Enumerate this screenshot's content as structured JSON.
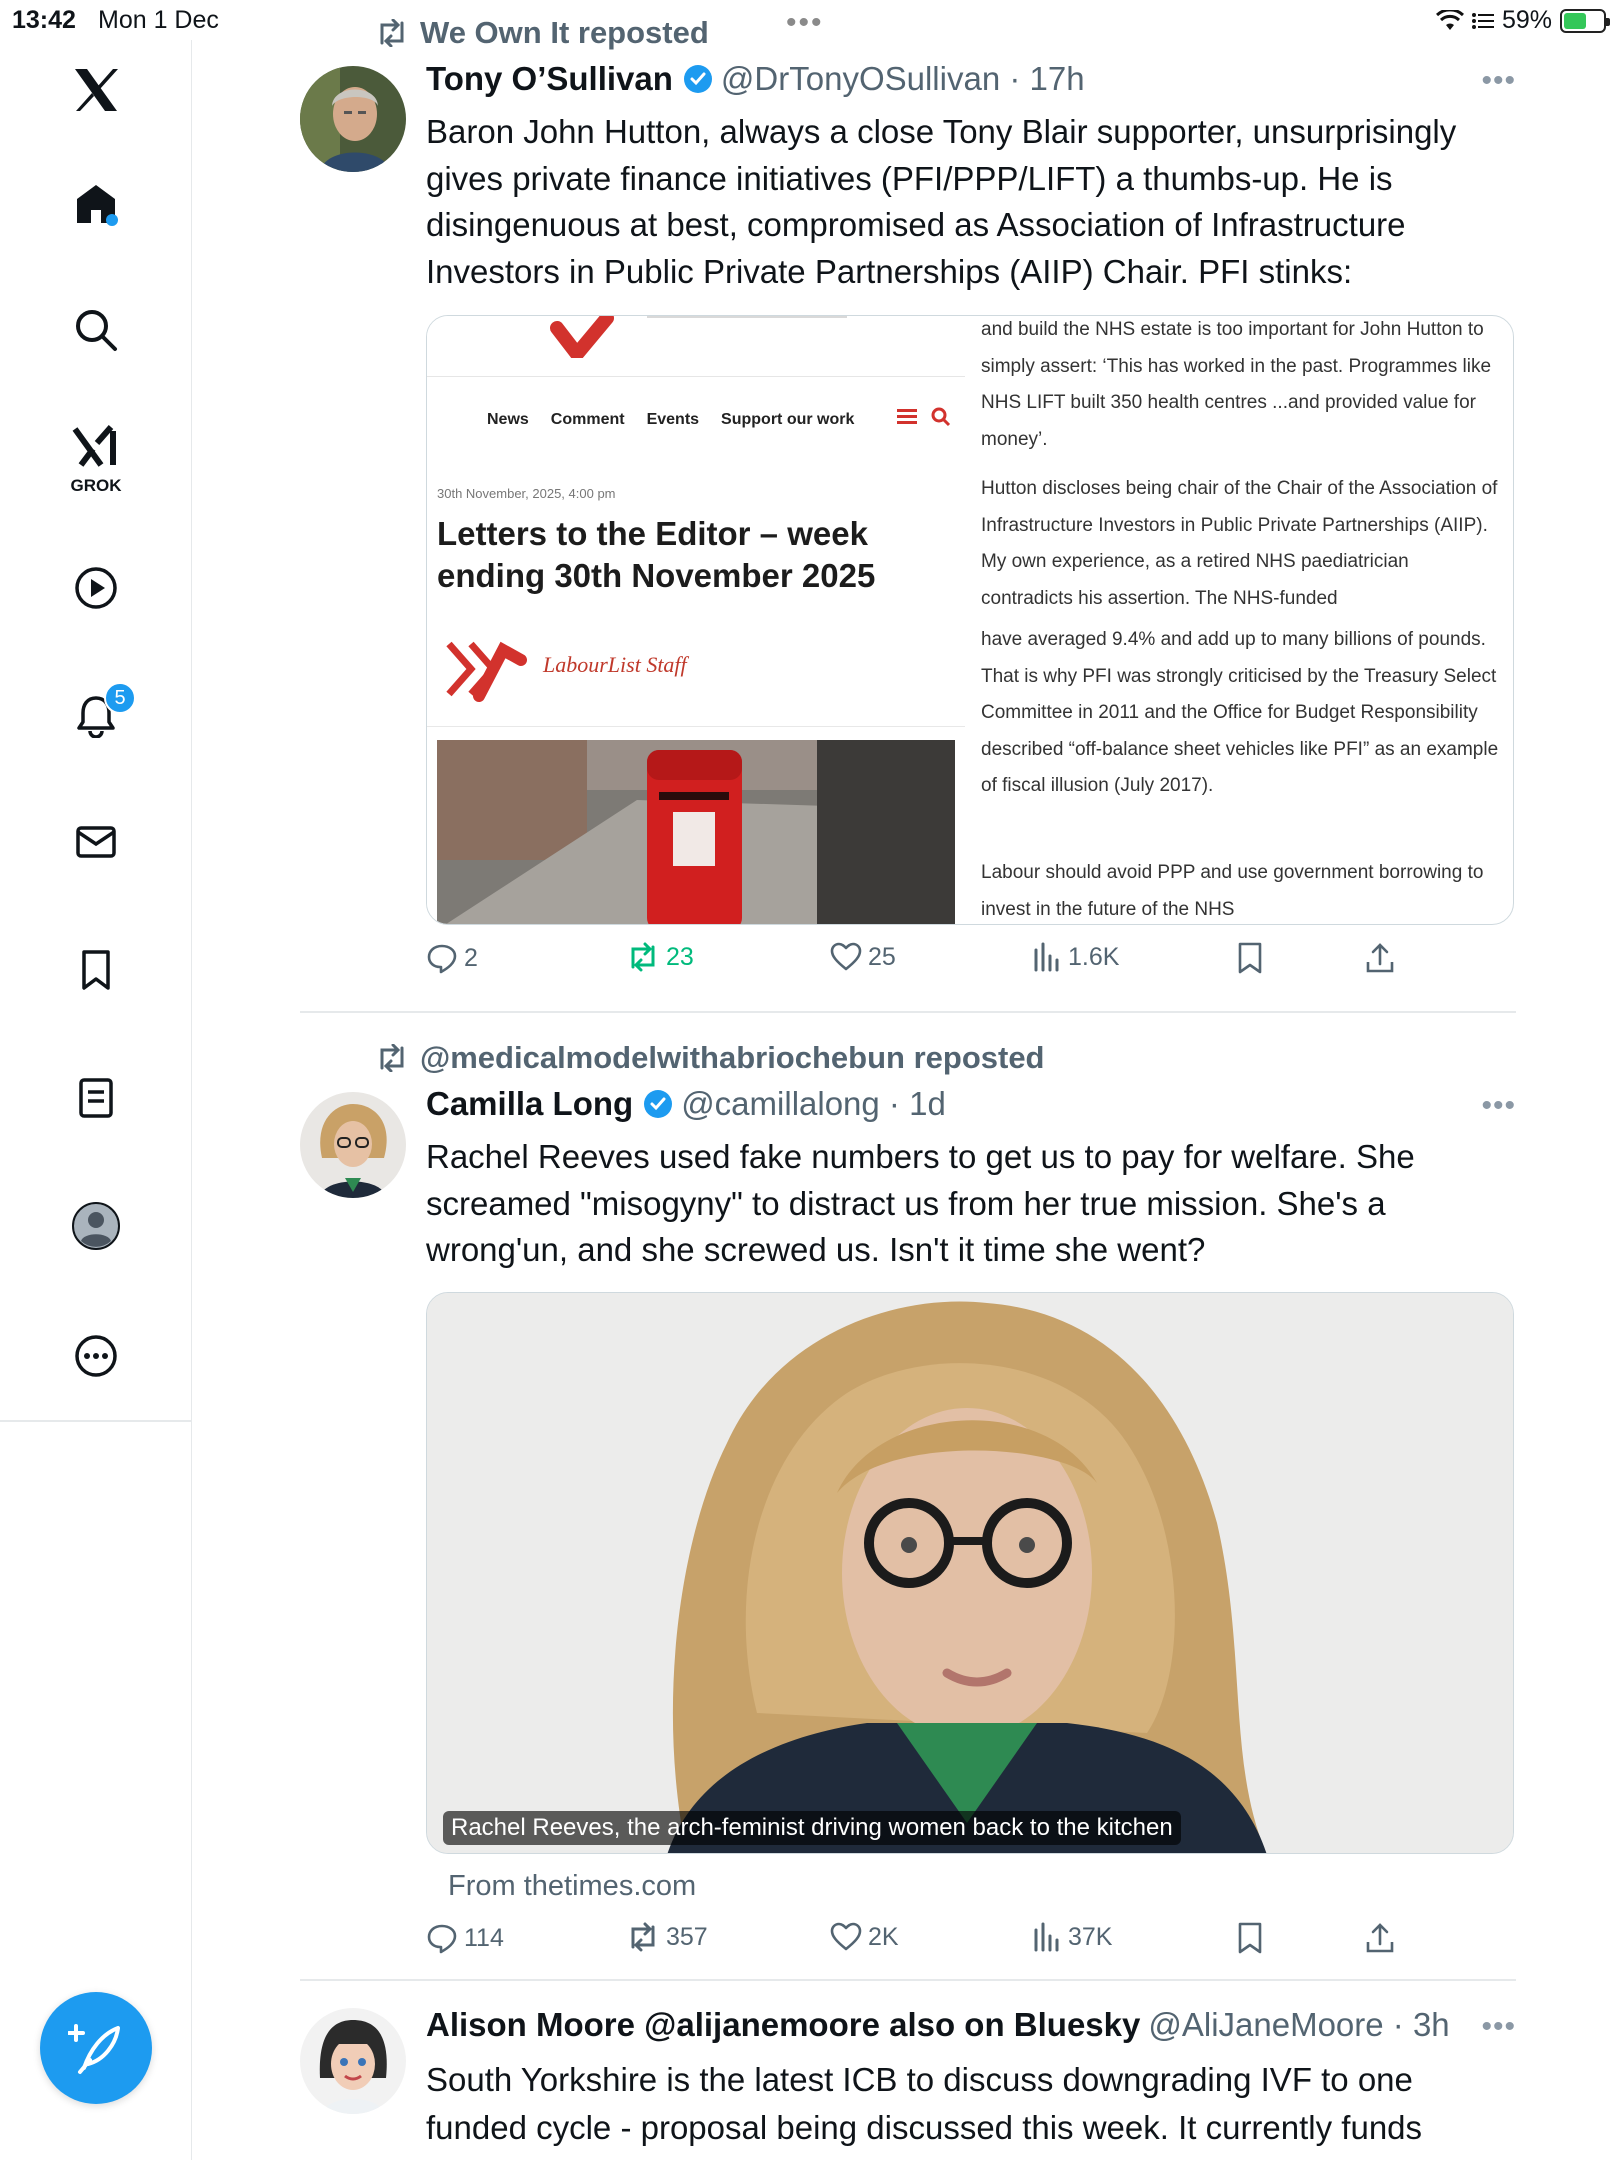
{
  "status_bar": {
    "time": "13:42",
    "date": "Mon 1 Dec",
    "battery": "59%",
    "battery_fill": 0.59
  },
  "sidebar": {
    "items": [
      {
        "name": "x-logo",
        "icon": "x-logo-icon"
      },
      {
        "name": "home",
        "icon": "home-icon",
        "has_dot": true
      },
      {
        "name": "explore",
        "icon": "search-icon"
      },
      {
        "name": "grok",
        "icon": "grok-icon",
        "label": "GROK"
      },
      {
        "name": "video",
        "icon": "play-icon"
      },
      {
        "name": "notifications",
        "icon": "bell-icon",
        "badge": "5"
      },
      {
        "name": "messages",
        "icon": "mail-icon"
      },
      {
        "name": "bookmarks",
        "icon": "bookmark-icon"
      },
      {
        "name": "articles",
        "icon": "article-icon"
      },
      {
        "name": "profile",
        "icon": "profile-icon"
      },
      {
        "name": "more",
        "icon": "more-icon"
      }
    ],
    "compose_icon": "compose-feather-icon"
  },
  "colors": {
    "accent": "#1d9bf0",
    "secondary_text": "#536471",
    "repost_green": "#00ba7c",
    "border": "#cfd9de"
  },
  "posts": [
    {
      "repost_by": "We Own It reposted",
      "name": "Tony O’Sullivan",
      "verified": true,
      "handle": "@DrTonyOSullivan · 17h",
      "text": "Baron John Hutton, always a close Tony Blair supporter, unsurprisingly gives private finance initiatives (PFI/PPP/LIFT) a thumbs-up. He is disingenuous at best, compromised as Association of Infrastructure Investors in Public Private Partnerships (AIIP) Chair. PFI stinks:",
      "media": {
        "nav_items": [
          "News",
          "Comment",
          "Events",
          "Support our work"
        ],
        "date": "30th November, 2025, 4:00 pm",
        "title": "Letters to the Editor – week ending 30th November 2025",
        "byline": "LabourList Staff",
        "paragraphs": [
          "and build the NHS estate is too important for John Hutton to simply assert: ‘This has worked in the past. Programmes like NHS LIFT built 350 health centres ...and provided value for money’.",
          "Hutton discloses being chair of the Chair of the Association of Infrastructure Investors in Public Private Partnerships (AIIP). My own experience, as a retired NHS paediatrician contradicts his assertion. The NHS-funded",
          "have averaged 9.4% and add up to many billions of pounds. That is why PFI was strongly criticised by the Treasury Select Committee in 2011 and the Office for Budget Responsibility described “off-balance sheet vehicles like PFI” as an example of fiscal illusion (July 2017).",
          "Labour should avoid PPP and use government borrowing to invest in the future of the NHS"
        ]
      },
      "actions": {
        "replies": "2",
        "reposts": "23",
        "likes": "25",
        "views": "1.6K"
      }
    },
    {
      "repost_by": "@medicalmodelwithabriochebun reposted",
      "name": "Camilla Long",
      "verified": true,
      "handle": "@camillalong · 1d",
      "text": "Rachel Reeves used fake numbers to get us to pay for welfare. She screamed \"misogyny\" to distract us from her true mission. She's a wrong'un, and she screwed us. Isn't it time she went?",
      "media": {
        "caption": "Rachel Reeves, the arch-feminist driving women back to the kitchen",
        "source": "From thetimes.com"
      },
      "actions": {
        "replies": "114",
        "reposts": "357",
        "likes": "2K",
        "views": "37K"
      }
    },
    {
      "name": "Alison Moore @alijanemoore also on Bluesky",
      "handle": "@AliJaneMoore · 3h",
      "text": "South Yorkshire is the latest ICB to discuss downgrading IVF to one funded cycle - proposal being discussed this week. It currently funds"
    }
  ]
}
